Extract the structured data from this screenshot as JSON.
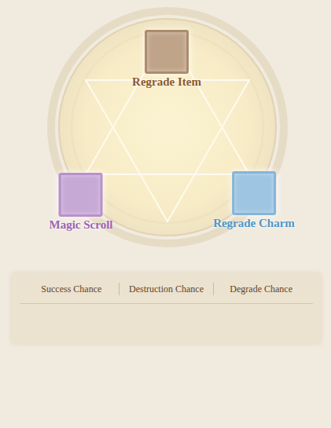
{
  "slots": [
    {
      "label": "Regrade Item",
      "color": "#8a5a2a"
    },
    {
      "label": "Magic Scroll",
      "color": "#9a62b4"
    },
    {
      "label": "Regrade Charm",
      "color": "#4f95c8"
    }
  ],
  "chances": {
    "columns": [
      "Success Chance",
      "Destruction Chance",
      "Degrade Chance"
    ]
  }
}
